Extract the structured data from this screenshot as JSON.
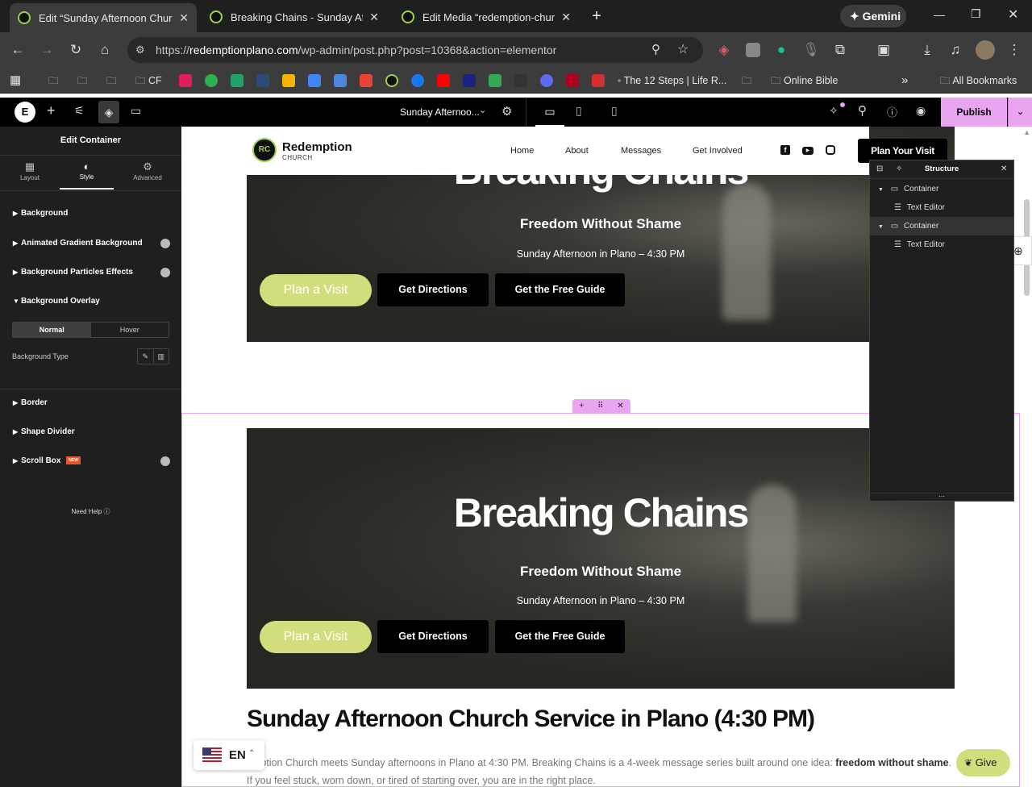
{
  "browser": {
    "tabs": [
      {
        "title": "Edit “Sunday Afternoon Church",
        "active": true
      },
      {
        "title": "Breaking Chains - Sunday After",
        "active": false
      },
      {
        "title": "Edit Media “redemption-church",
        "active": false
      }
    ],
    "new_tab": "+",
    "gemini": "Gemini",
    "url_prefix": "https://",
    "url_host": "redemptionplano.com",
    "url_path": "/wp-admin/post.php?post=10368&action=elementor",
    "bookmarks": {
      "cf": "CF",
      "steps": "The 12 Steps | Life R...",
      "bible": "Online Bible",
      "all": "All Bookmarks",
      "more": "»"
    }
  },
  "editor": {
    "page_title": "Sunday Afternoo...",
    "publish": "Publish",
    "panel_title": "Edit Container",
    "tabs": [
      "Layout",
      "Style",
      "Advanced"
    ],
    "sections": [
      "Background",
      "Animated Gradient Background",
      "Background Particles Effects",
      "Background Overlay",
      "Border",
      "Shape Divider",
      "Scroll Box"
    ],
    "new_badge": "NEW",
    "overlay_tabs": [
      "Normal",
      "Hover"
    ],
    "bg_type_label": "Background Type",
    "need_help": "Need Help"
  },
  "structure": {
    "title": "Structure",
    "items": [
      "Container",
      "Text Editor",
      "Container",
      "Text Editor"
    ]
  },
  "site": {
    "logo_name": "Redemption",
    "logo_sub": "CHURCH",
    "nav": [
      "Home",
      "About",
      "Messages",
      "Get Involved"
    ],
    "cta": "Plan Your Visit"
  },
  "hero": {
    "title": "Breaking Chains",
    "subtitle": "Freedom Without Shame",
    "time": "Sunday Afternoon in Plano – 4:30 PM",
    "plan": "Plan a Visit",
    "directions": "Get Directions",
    "guide": "Get the Free Guide"
  },
  "content": {
    "heading": "Sunday Afternoon Church Service in Plano (4:30 PM)",
    "para_start": "emption Church meets Sunday afternoons in Plano at 4:30 PM. Breaking Chains is a 4-week message series built around one idea: ",
    "para_bold1": "freedom without",
    "para_bold2": "shame",
    "para_end": ". If you feel stuck, worn down, or tired of starting over, you are in the right place."
  },
  "lang": "EN",
  "give": "Give",
  "colors": {
    "accent": "#e9a5f0",
    "lime": "#d4dd7e",
    "dark": "#000000"
  }
}
